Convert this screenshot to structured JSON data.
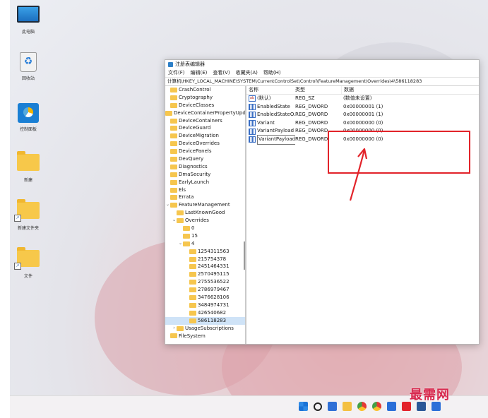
{
  "desktop": {
    "icons": [
      {
        "label": "此电脑",
        "icon": "computer-icon"
      },
      {
        "label": "回收站",
        "icon": "recycle-bin-icon"
      },
      {
        "label": "控制面板",
        "icon": "control-panel-icon"
      },
      {
        "label": "新建",
        "icon": "folder-icon"
      },
      {
        "label": "新建文件夹",
        "icon": "folder-shortcut-icon"
      },
      {
        "label": "文件",
        "icon": "folder-shortcut-icon"
      }
    ]
  },
  "window": {
    "title": "注册表编辑器",
    "menu": [
      "文件(F)",
      "编辑(E)",
      "查看(V)",
      "收藏夹(A)",
      "帮助(H)"
    ],
    "address": "计算机\\HKEY_LOCAL_MACHINE\\SYSTEM\\CurrentControlSet\\Control\\FeatureManagement\\Overrides\\4\\586118283",
    "tree": [
      {
        "label": "CrashControl",
        "indent": 0,
        "chev": ""
      },
      {
        "label": "Cryptography",
        "indent": 0,
        "chev": ""
      },
      {
        "label": "DeviceClasses",
        "indent": 0,
        "chev": ""
      },
      {
        "label": "DeviceContainerPropertyUpda",
        "indent": 0,
        "chev": ""
      },
      {
        "label": "DeviceContainers",
        "indent": 0,
        "chev": ""
      },
      {
        "label": "DeviceGuard",
        "indent": 0,
        "chev": ""
      },
      {
        "label": "DeviceMigration",
        "indent": 0,
        "chev": ""
      },
      {
        "label": "DeviceOverrides",
        "indent": 0,
        "chev": ""
      },
      {
        "label": "DevicePanels",
        "indent": 0,
        "chev": ""
      },
      {
        "label": "DevQuery",
        "indent": 0,
        "chev": ""
      },
      {
        "label": "Diagnostics",
        "indent": 0,
        "chev": ""
      },
      {
        "label": "DmaSecurity",
        "indent": 0,
        "chev": ""
      },
      {
        "label": "EarlyLaunch",
        "indent": 0,
        "chev": ""
      },
      {
        "label": "Els",
        "indent": 0,
        "chev": ""
      },
      {
        "label": "Errata",
        "indent": 0,
        "chev": ""
      },
      {
        "label": "FeatureManagement",
        "indent": 0,
        "chev": "v"
      },
      {
        "label": "LastKnownGood",
        "indent": 1,
        "chev": ""
      },
      {
        "label": "Overrides",
        "indent": 1,
        "chev": "v"
      },
      {
        "label": "0",
        "indent": 2,
        "chev": ""
      },
      {
        "label": "15",
        "indent": 2,
        "chev": ""
      },
      {
        "label": "4",
        "indent": 2,
        "chev": "v"
      },
      {
        "label": "1254311563",
        "indent": 3,
        "chev": ""
      },
      {
        "label": "215754378",
        "indent": 3,
        "chev": ""
      },
      {
        "label": "2451464331",
        "indent": 3,
        "chev": ""
      },
      {
        "label": "2570495115",
        "indent": 3,
        "chev": ""
      },
      {
        "label": "2755536522",
        "indent": 3,
        "chev": ""
      },
      {
        "label": "2786979467",
        "indent": 3,
        "chev": ""
      },
      {
        "label": "3476628106",
        "indent": 3,
        "chev": ""
      },
      {
        "label": "3484974731",
        "indent": 3,
        "chev": ""
      },
      {
        "label": "426540682",
        "indent": 3,
        "chev": ""
      },
      {
        "label": "586118283",
        "indent": 3,
        "chev": "",
        "selected": true
      },
      {
        "label": "UsageSubscriptions",
        "indent": 1,
        "chev": ">"
      },
      {
        "label": "FileSystem",
        "indent": 0,
        "chev": ""
      }
    ],
    "columns": {
      "name": "名称",
      "type": "类型",
      "data": "数据"
    },
    "values": [
      {
        "name": "(默认)",
        "type": "REG_SZ",
        "data": "(数值未设置)",
        "kind": "sz"
      },
      {
        "name": "EnabledState",
        "type": "REG_DWORD",
        "data": "0x00000001 (1)",
        "kind": "dword"
      },
      {
        "name": "EnabledStateO...",
        "type": "REG_DWORD",
        "data": "0x00000001 (1)",
        "kind": "dword"
      },
      {
        "name": "Variant",
        "type": "REG_DWORD",
        "data": "0x00000000 (0)",
        "kind": "dword"
      },
      {
        "name": "VariantPayload",
        "type": "REG_DWORD",
        "data": "0x00000000 (0)",
        "kind": "dword"
      },
      {
        "name": "VariantPayload...",
        "type": "REG_DWORD",
        "data": "0x00000000 (0)",
        "kind": "dword",
        "boxed": true
      }
    ],
    "highlight_color": "#e2232a"
  },
  "taskbar": {
    "icons": [
      "start-icon",
      "search-icon",
      "task-view-icon",
      "file-explorer-icon",
      "chrome-icon",
      "chrome-icon",
      "microsoft-store-icon",
      "office-icon",
      "word-icon",
      "edge-icon"
    ]
  },
  "watermark": "最需网"
}
